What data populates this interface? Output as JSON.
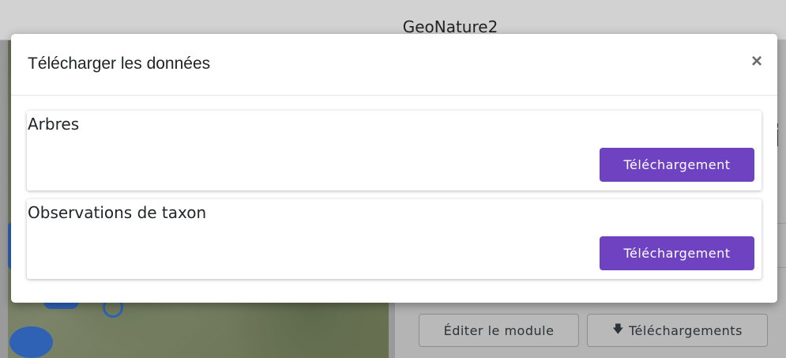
{
  "app": {
    "title": "GeoNature2"
  },
  "background": {
    "edit_module_label": "Éditer le module",
    "downloads_label": "Téléchargements",
    "downloads_icon": "arrow-down-icon"
  },
  "modal": {
    "title": "Télécharger les données",
    "close_label": "×",
    "exports": [
      {
        "name": "Arbres",
        "button_label": "Téléchargement"
      },
      {
        "name": "Observations de taxon",
        "button_label": "Téléchargement"
      }
    ]
  },
  "colors": {
    "button_bg": "#6f42c1",
    "button_text": "#ffffff",
    "overlay": "#9a9a9a"
  }
}
